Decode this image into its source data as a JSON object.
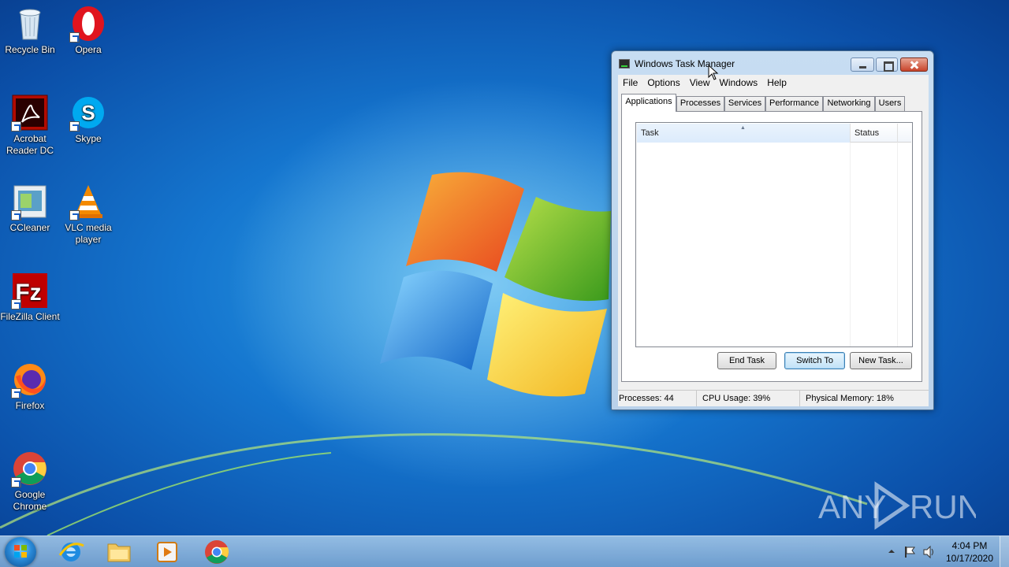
{
  "desktop": {
    "icons": [
      {
        "label": "Recycle Bin"
      },
      {
        "label": "Opera"
      },
      {
        "label": "Acrobat Reader DC"
      },
      {
        "label": "Skype"
      },
      {
        "label": "CCleaner"
      },
      {
        "label": "VLC media player"
      },
      {
        "label": "FileZilla Client"
      },
      {
        "label": "Firefox"
      },
      {
        "label": "Google Chrome"
      }
    ]
  },
  "task_manager": {
    "title": "Windows Task Manager",
    "menu": [
      "File",
      "Options",
      "View",
      "Windows",
      "Help"
    ],
    "tabs": [
      "Applications",
      "Processes",
      "Services",
      "Performance",
      "Networking",
      "Users"
    ],
    "active_tab": "Applications",
    "columns": {
      "task": "Task",
      "status": "Status"
    },
    "buttons": {
      "end_task": "End Task",
      "switch_to": "Switch To",
      "new_task": "New Task..."
    },
    "status": {
      "processes": "Processes: 44",
      "cpu": "CPU Usage: 39%",
      "memory": "Physical Memory: 18%"
    }
  },
  "taskbar": {
    "apps": [
      "internet-explorer-icon",
      "windows-explorer-icon",
      "media-player-icon",
      "chrome-icon"
    ],
    "time": "4:04 PM",
    "date": "10/17/2020"
  },
  "watermark": {
    "left": "ANY",
    "right": "RUN"
  }
}
